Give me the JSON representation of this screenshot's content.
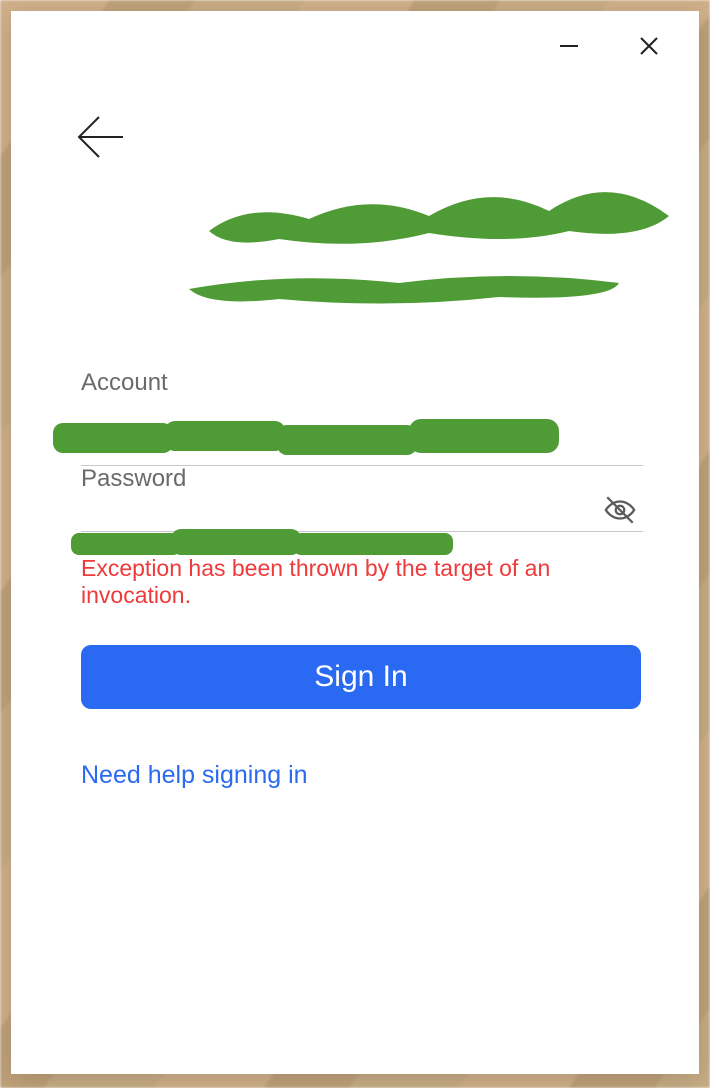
{
  "titlebar": {
    "minimize_name": "minimize",
    "close_name": "close"
  },
  "back_name": "back",
  "form": {
    "account_label": "Account",
    "password_label": "Password",
    "password_toggle_name": "show-password",
    "error_text": "Exception has been thrown by the target of an invocation.",
    "signin_label": "Sign In",
    "help_label": "Need help signing in"
  },
  "colors": {
    "primary": "#2a6af3",
    "error": "#ee3a3a",
    "redaction": "#4f9b35"
  }
}
